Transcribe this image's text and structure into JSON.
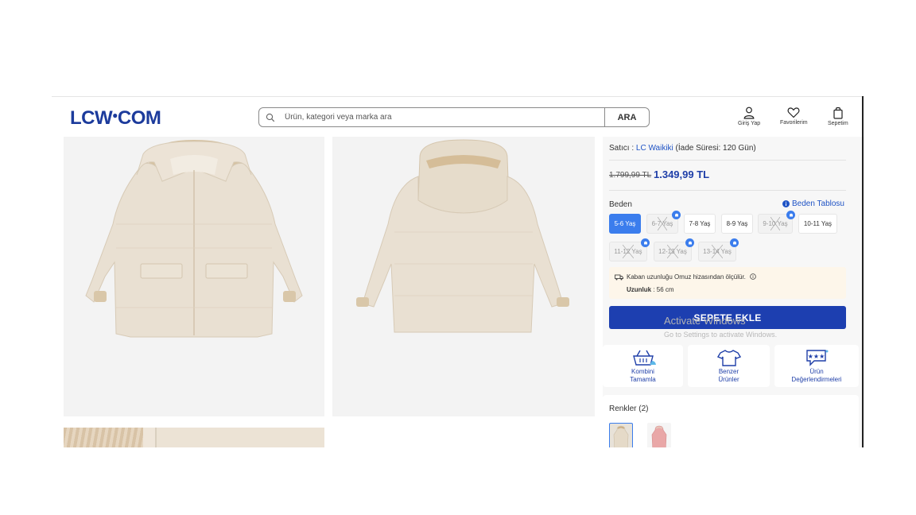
{
  "header": {
    "logo": "LCW",
    "logo_tail": "COM",
    "search_placeholder": "Ürün, kategori veya marka ara",
    "search_button": "ARA",
    "login_label": "Giriş Yap",
    "favorites_label": "Favorilerim",
    "cart_label": "Sepetim"
  },
  "product": {
    "seller_prefix": "Satıcı :",
    "seller_name": "LC Waikiki",
    "return_info": "(İade Süresi: 120 Gün)",
    "price_old": "1.799,99 TL",
    "price_new": "1.349,99 TL",
    "size_label": "Beden",
    "size_table_label": "Beden Tablosu",
    "sizes": [
      {
        "label": "5-6 Yaş",
        "state": "selected"
      },
      {
        "label": "6-7 Yaş",
        "state": "out_of_stock"
      },
      {
        "label": "7-8 Yaş",
        "state": "available"
      },
      {
        "label": "8-9 Yaş",
        "state": "available"
      },
      {
        "label": "9-10 Yaş",
        "state": "out_of_stock"
      },
      {
        "label": "10-11 Yaş",
        "state": "available"
      },
      {
        "label": "11-12 Yaş",
        "state": "out_of_stock"
      },
      {
        "label": "12-13 Yaş",
        "state": "out_of_stock"
      },
      {
        "label": "13-14 Yaş",
        "state": "out_of_stock"
      }
    ],
    "measure_note": "Kaban uzunluğu Omuz hizasından ölçülür.",
    "length_label": "Uzunluk",
    "length_value": ": 56 cm",
    "add_to_cart": "SEPETE EKLE",
    "features": [
      {
        "line1": "Kombini",
        "line2": "Tamamla",
        "icon": "basket-icon"
      },
      {
        "line1": "Benzer",
        "line2": "Ürünler",
        "icon": "tshirt-icon"
      },
      {
        "line1": "Ürün",
        "line2": "Değerlendirmeleri",
        "icon": "review-bubble-icon"
      }
    ],
    "colors_label": "Renkler (2)",
    "colors": [
      "#e8e2d8",
      "#e9a7a7"
    ]
  },
  "colors": {
    "brand": "#1c3b9c",
    "accent": "#3b7ded",
    "cart_button": "#1d3fb0",
    "coat": "#e9e0d2"
  },
  "watermark": {
    "title": "Activate Windows",
    "subtitle": "Go to Settings to activate Windows."
  }
}
